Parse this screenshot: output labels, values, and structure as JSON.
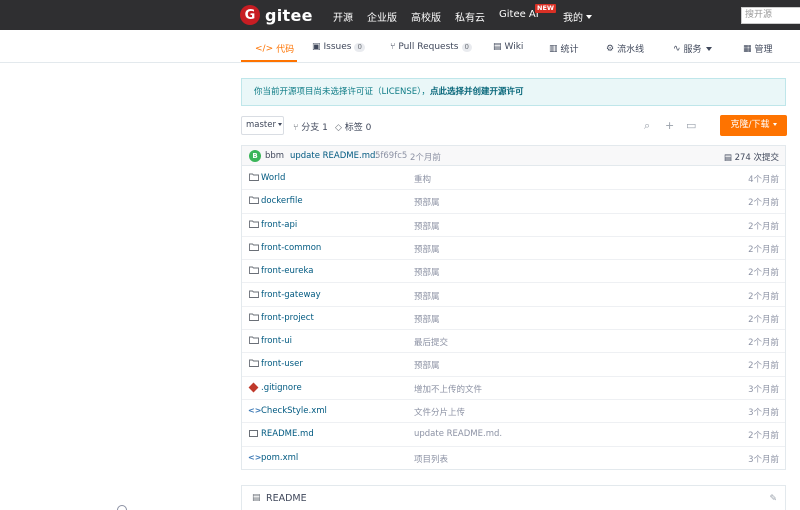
{
  "header": {
    "logo_mark": "G",
    "logo_text": "gitee",
    "nav": [
      "开源",
      "企业版",
      "高校版",
      "私有云",
      "Gitee AI"
    ],
    "new_badge": "NEW",
    "user_menu": "我的",
    "search_placeholder": "搜开源"
  },
  "tabs": {
    "code": "代码",
    "issues": "Issues",
    "issues_count": "0",
    "pull_requests": "Pull Requests",
    "pull_requests_count": "0",
    "wiki": "Wiki",
    "stats": "统计",
    "pipeline": "流水线",
    "service": "服务",
    "manage": "管理"
  },
  "notice": {
    "text": "你当前开源项目尚未选择许可证（LICENSE），",
    "link": "点此选择并创建开源许可"
  },
  "toolbar": {
    "branch": "master",
    "branches": "分支 1",
    "tags": "标签 0",
    "clone_button": "克隆/下载"
  },
  "last_commit": {
    "avatar_letter": "B",
    "author": "bbm",
    "message": "update README.md.",
    "sha": "5f69fc5",
    "time": "2个月前",
    "total_commits": "274 次提交"
  },
  "files": [
    {
      "type": "folder",
      "name": "World",
      "message": "重构",
      "time": "4个月前"
    },
    {
      "type": "folder",
      "name": "dockerfile",
      "message": "预部属",
      "time": "2个月前"
    },
    {
      "type": "folder",
      "name": "front-api",
      "message": "预部属",
      "time": "2个月前"
    },
    {
      "type": "folder",
      "name": "front-common",
      "message": "预部属",
      "time": "2个月前"
    },
    {
      "type": "folder",
      "name": "front-eureka",
      "message": "预部属",
      "time": "2个月前"
    },
    {
      "type": "folder",
      "name": "front-gateway",
      "message": "预部属",
      "time": "2个月前"
    },
    {
      "type": "folder",
      "name": "front-project",
      "message": "预部属",
      "time": "2个月前"
    },
    {
      "type": "folder",
      "name": "front-ui",
      "message": "最后提交",
      "time": "2个月前"
    },
    {
      "type": "folder",
      "name": "front-user",
      "message": "预部属",
      "time": "2个月前"
    },
    {
      "type": "gitignore",
      "name": ".gitignore",
      "message": "增加不上传的文件",
      "time": "3个月前"
    },
    {
      "type": "code",
      "name": "CheckStyle.xml",
      "message": "文件分片上传",
      "time": "3个月前"
    },
    {
      "type": "readme",
      "name": "README.md",
      "message": "update README.md.",
      "time": "2个月前"
    },
    {
      "type": "code",
      "name": "pom.xml",
      "message": "项目列表",
      "time": "3个月前"
    }
  ],
  "readme": {
    "title": "README"
  }
}
